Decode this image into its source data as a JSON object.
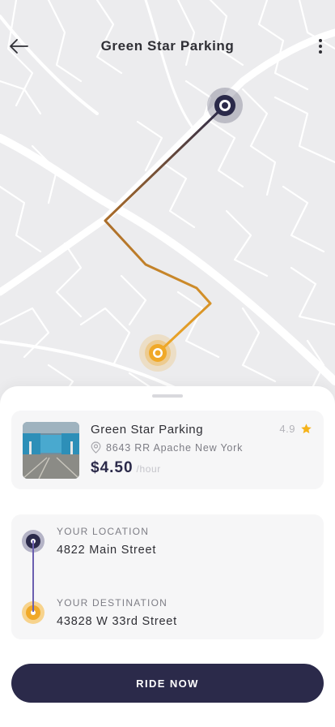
{
  "header": {
    "title": "Green Star Parking"
  },
  "parking": {
    "name": "Green Star Parking",
    "rating": "4.9",
    "address": "8643 RR Apache New York",
    "price": "$4.50",
    "price_unit": "/hour"
  },
  "route": {
    "origin_label": "YOUR LOCATION",
    "origin_value": "4822 Main Street",
    "destination_label": "YOUR DESTINATION",
    "destination_value": "43828 W 33rd Street"
  },
  "actions": {
    "ride_label": "RIDE NOW"
  },
  "icons": {
    "back": "arrow-left-icon",
    "more": "more-vertical-icon",
    "star": "star-icon",
    "pin": "location-pin-icon"
  },
  "colors": {
    "primary": "#2b2a4a",
    "accent": "#f0a928",
    "star": "#f5b31a",
    "map_background": "#ececee",
    "map_roads": "#ffffff"
  }
}
